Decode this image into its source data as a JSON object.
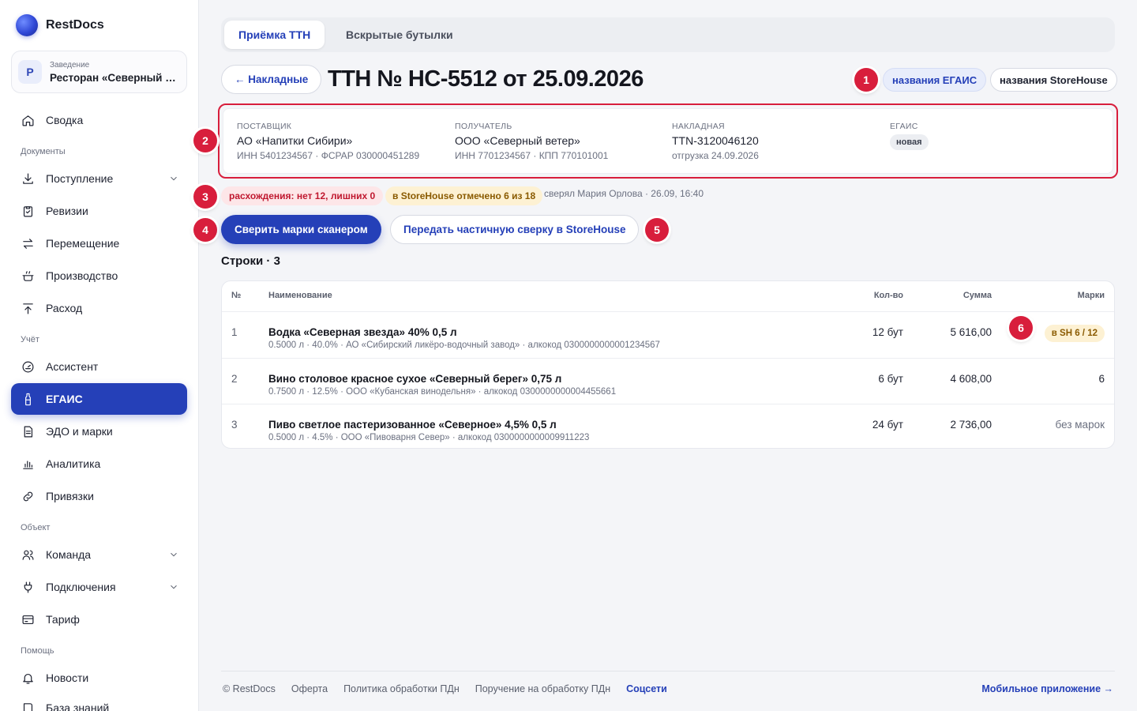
{
  "brand": {
    "name": "RestDocs"
  },
  "venue": {
    "label": "Заведение",
    "avatar": "Р",
    "name": "Ресторан «Северный ветер»"
  },
  "sidebar": {
    "summary": "Сводка",
    "section_docs": "Документы",
    "income": "Поступление",
    "audit": "Ревизии",
    "transfer": "Перемещение",
    "production": "Производство",
    "expense": "Расход",
    "section_accounting": "Учёт",
    "assistant": "Ассистент",
    "egais": "ЕГАИС",
    "edo": "ЭДО и марки",
    "analytics": "Аналитика",
    "bindings": "Привязки",
    "section_object": "Объект",
    "team": "Команда",
    "connections": "Подключения",
    "tariff": "Тариф",
    "section_help": "Помощь",
    "news": "Новости",
    "kb": "База знаний"
  },
  "tabs": {
    "ttn": "Приёмка ТТН",
    "opened": "Вскрытые бутылки"
  },
  "header": {
    "back_label": "← Накладные",
    "title": "ТТН № НС-5512 от 25.09.2026",
    "names_egais": "названия ЕГАИС",
    "names_sh": "названия StoreHouse"
  },
  "info": {
    "supplier_label": "ПОСТАВЩИК",
    "supplier_name": "АО «Напитки Сибири»",
    "supplier_sub": "ИНН 5401234567 · ФСРАР 030000451289",
    "recipient_label": "ПОЛУЧАТЕЛЬ",
    "recipient_name": "ООО «Северный ветер»",
    "recipient_sub": "ИНН 7701234567 · КПП 770101001",
    "invoice_label": "НАКЛАДНАЯ",
    "invoice_number": "TTN-3120046120",
    "invoice_sub": "отгрузка 24.09.2026",
    "egais_label": "ЕГАИС",
    "egais_status": "новая"
  },
  "status": {
    "discrepancy": "расхождения: нет 12, лишних 0",
    "storehouse": "в StoreHouse отмечено 6 из 18",
    "checked_by": "сверял Мария Орлова · 26.09, 16:40"
  },
  "actions": {
    "scan": "Сверить марки сканером",
    "partial": "Передать частичную сверку в StoreHouse"
  },
  "rows_title": "Строки · 3",
  "table": {
    "headers": {
      "num": "№",
      "name": "Наименование",
      "qty": "Кол-во",
      "sum": "Сумма",
      "marks": "Марки"
    },
    "rows": [
      {
        "num": "1",
        "name": "Водка «Северная звезда» 40% 0,5 л",
        "meta": "0.5000 л · 40.0% · АО «Сибирский ликёро-водочный завод» · алкокод 0300000000001234567",
        "qty": "12 бут",
        "sum": "5 616,00",
        "marks": "в SH 6 / 12"
      },
      {
        "num": "2",
        "name": "Вино столовое красное сухое «Северный берег» 0,75 л",
        "meta": "0.7500 л · 12.5% · ООО «Кубанская винодельня» · алкокод 0300000000004455661",
        "qty": "6 бут",
        "sum": "4 608,00",
        "marks": "6"
      },
      {
        "num": "3",
        "name": "Пиво светлое пастеризованное «Северное» 4,5% 0,5 л",
        "meta": "0.5000 л · 4.5% · ООО «Пивоварня Север» · алкокод 0300000000009911223",
        "qty": "24 бут",
        "sum": "2 736,00",
        "marks": "без марок"
      }
    ]
  },
  "callouts": {
    "c1": "1",
    "c2": "2",
    "c3": "3",
    "c4": "4",
    "c5": "5",
    "c6": "6"
  },
  "footer": {
    "copyright": "© RestDocs",
    "offer": "Оферта",
    "privacy": "Политика обработки ПДн",
    "processing": "Поручение на обработку ПДн",
    "social": "Соцсети",
    "mobile": "Мобильное приложение →"
  },
  "colors": {
    "accent": "#2540b8",
    "danger": "#d81e3c",
    "warning_bg": "#fdf1d3"
  },
  "icons": [
    "home-icon",
    "download-icon",
    "clipboard-check-icon",
    "arrows-swap-icon",
    "pot-icon",
    "arrow-up-icon",
    "gauge-icon",
    "bottle-icon",
    "document-icon",
    "bar-chart-icon",
    "link-icon",
    "users-icon",
    "plug-icon",
    "card-icon",
    "bell-icon",
    "book-icon",
    "chevron-down-icon"
  ]
}
